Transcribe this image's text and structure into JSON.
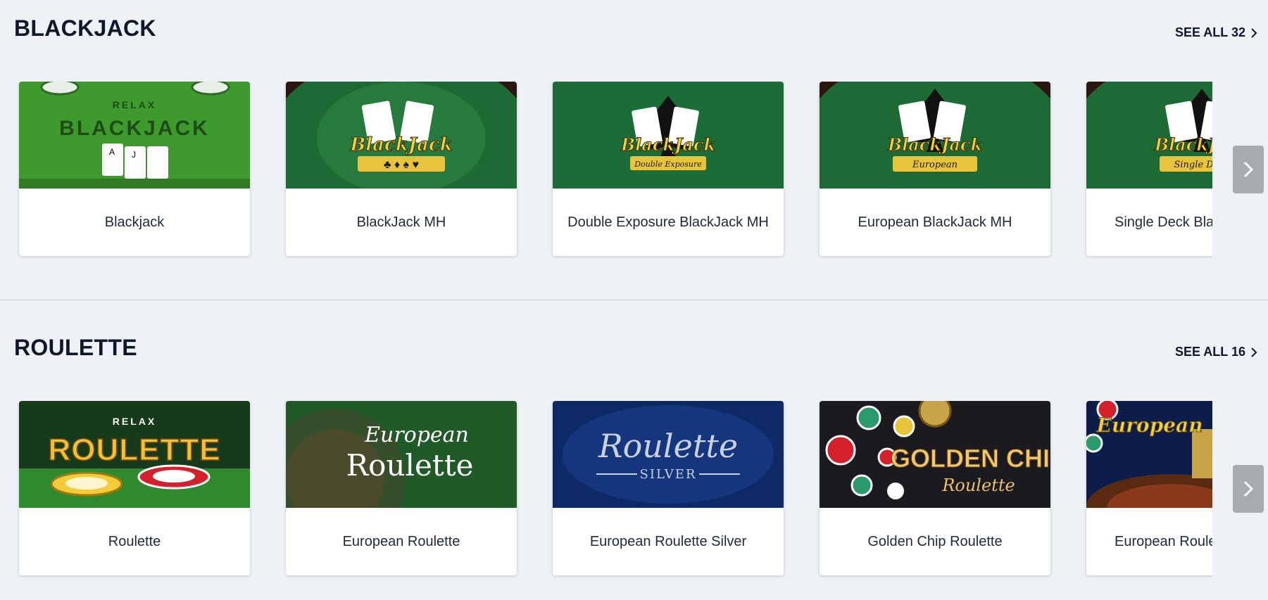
{
  "sections": [
    {
      "title": "BLACKJACK",
      "see_all": "SEE ALL 32",
      "games": [
        {
          "name": "Blackjack",
          "art": "RELAX BLACKJACK"
        },
        {
          "name": "BlackJack MH",
          "art": "BlackJack"
        },
        {
          "name": "Double Exposure BlackJack MH",
          "art": "BlackJack Double Exposure"
        },
        {
          "name": "European BlackJack MH",
          "art": "BlackJack European"
        },
        {
          "name": "Single Deck BlackJack MH",
          "art": "BlackJack Single Deck"
        }
      ]
    },
    {
      "title": "ROULETTE",
      "see_all": "SEE ALL 16",
      "games": [
        {
          "name": "Roulette",
          "art": "RELAX ROULETTE"
        },
        {
          "name": "European Roulette",
          "art": "European Roulette"
        },
        {
          "name": "European Roulette Silver",
          "art": "Roulette SILVER"
        },
        {
          "name": "Golden Chip Roulette",
          "art": "GOLDEN CHIP Roulette"
        },
        {
          "name": "European Roulette",
          "art": "European"
        }
      ]
    }
  ],
  "icons": {
    "see_all": "chevron-right-icon",
    "next": "chevron-right-icon"
  },
  "colors": {
    "background": "#eef2f6",
    "felt_green": "#1f6b3a",
    "gold": "#e8c43a",
    "nav_button": "#a9acae"
  }
}
